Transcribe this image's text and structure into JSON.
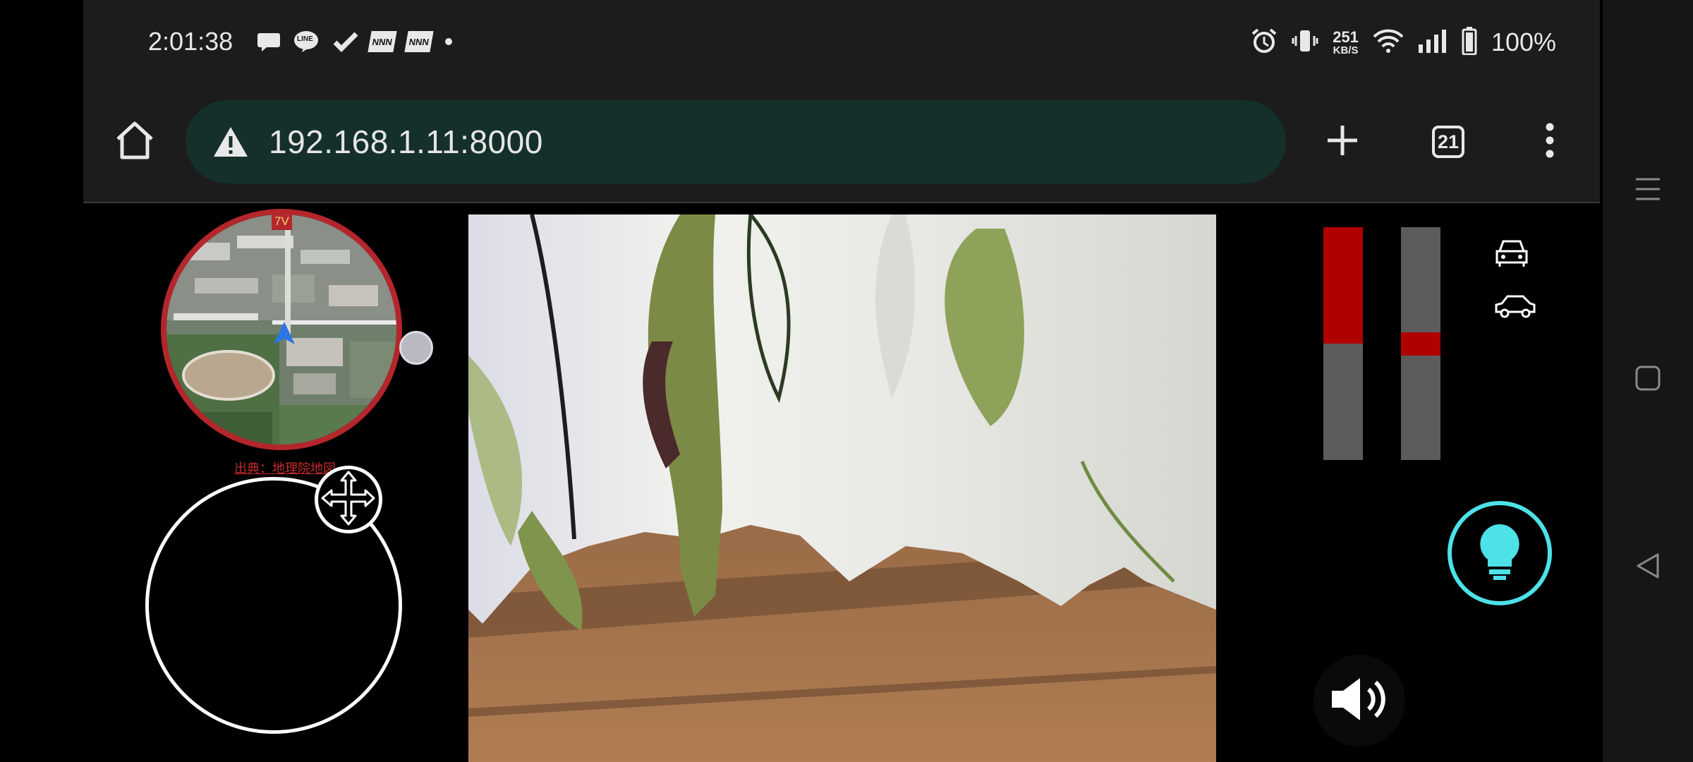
{
  "status_bar": {
    "time": "2:01:38",
    "notification_icons": [
      "chat-bubble-icon",
      "line-icon",
      "check-icon",
      "nnn-icon",
      "nnn-icon",
      "dot-icon"
    ],
    "line_badge": "LINE",
    "nnn_badge": "NNN",
    "net_speed_value": "251",
    "net_speed_unit": "KB/S",
    "battery_percent": "100%",
    "right_icons": [
      "alarm-icon",
      "vibrate-icon",
      "wifi-icon",
      "signal-icon",
      "battery-icon"
    ]
  },
  "browser": {
    "url": "192.168.1.11:8000",
    "security_icon": "warning-icon",
    "tab_count": "21",
    "buttons": [
      "home-icon",
      "plus-icon",
      "tabs-icon",
      "menu-dots-icon"
    ]
  },
  "map": {
    "attribution": "出典：地理院地図",
    "badge": "7V",
    "position_marker": "navigation-arrow-icon"
  },
  "gauges": {
    "left_level": 0.5,
    "right_level": 0.1,
    "colors": {
      "fill": "#b10000",
      "track": "#5c5c5c"
    }
  },
  "controls": {
    "vehicle_icons": [
      "car-front-icon",
      "car-side-icon"
    ],
    "light_icon": "lightbulb-icon",
    "light_color": "#4de1e8",
    "sound_icon": "speaker-icon",
    "joystick_icon": "move-arrows-icon"
  },
  "system_nav": [
    "recents-icon",
    "home-square-icon",
    "back-icon"
  ]
}
